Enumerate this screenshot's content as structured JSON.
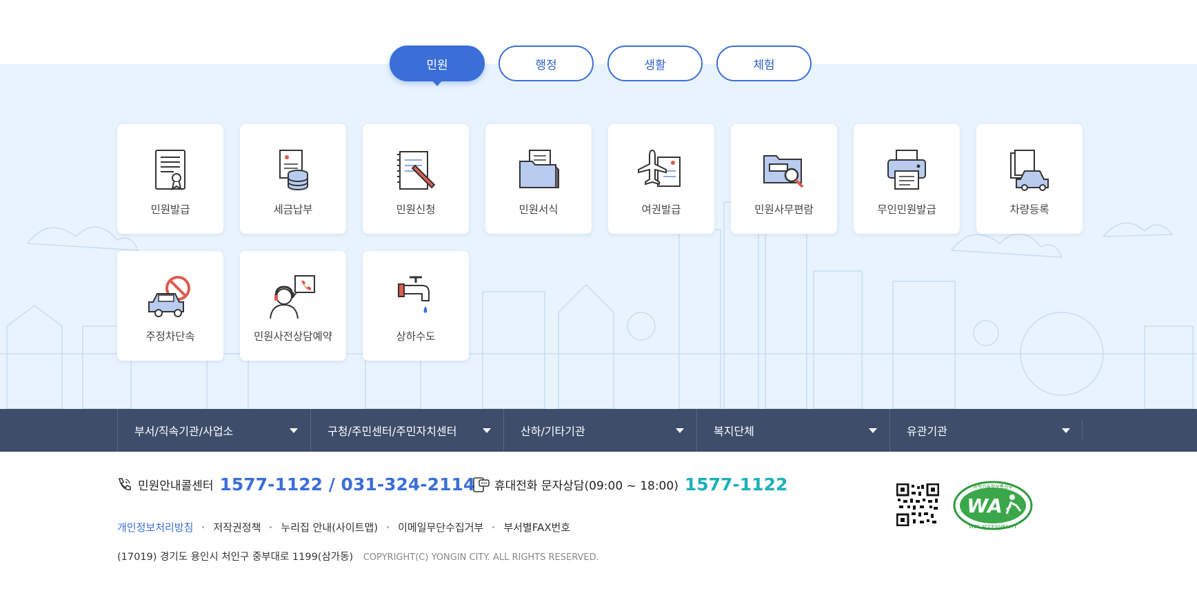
{
  "tabs": [
    {
      "label": "민원",
      "active": true
    },
    {
      "label": "행정",
      "active": false
    },
    {
      "label": "생활",
      "active": false
    },
    {
      "label": "체험",
      "active": false
    }
  ],
  "services": [
    {
      "label": "민원발급",
      "icon": "certificate-document-icon"
    },
    {
      "label": "세금납부",
      "icon": "tax-coins-icon"
    },
    {
      "label": "민원신청",
      "icon": "notebook-pen-icon"
    },
    {
      "label": "민원서식",
      "icon": "folder-document-icon"
    },
    {
      "label": "여권발급",
      "icon": "airplane-document-icon"
    },
    {
      "label": "민원사무편람",
      "icon": "folder-magnifier-icon"
    },
    {
      "label": "무인민원발급",
      "icon": "printer-icon"
    },
    {
      "label": "차량등록",
      "icon": "car-document-icon"
    },
    {
      "label": "주정차단속",
      "icon": "no-parking-car-icon"
    },
    {
      "label": "민원사전상담예약",
      "icon": "consultant-phone-icon"
    },
    {
      "label": "상하수도",
      "icon": "water-faucet-icon"
    }
  ],
  "agencies": [
    {
      "label": "부서/직속기관/사업소"
    },
    {
      "label": "구청/주민센터/주민자치센터"
    },
    {
      "label": "산하/기타기관"
    },
    {
      "label": "복지단체"
    },
    {
      "label": "유관기관"
    }
  ],
  "footer": {
    "call_center_label": "민원안내콜센터",
    "call_center_number": "1577-1122 / 031-324-2114",
    "sms_label": "휴대전화 문자상담(09:00 ~ 18:00)",
    "sms_number": "1577-1122",
    "links": [
      "개인정보처리방침",
      "저작권정책",
      "누리집 안내(사이트맵)",
      "이메일무단수집거부",
      "부서별FAX번호"
    ],
    "address": "(17019) 경기도 용인시 처인구 중부대로 1199(삼가동)",
    "copyright": "COPYRIGHT(C) YONGIN CITY. ALL RIGHTS RESERVED.",
    "wa_mark_top": "과학기술정보통신부",
    "wa_mark_bottom": "WEB ACCESSIBILITY",
    "wa_mark_logo": "WA"
  },
  "colors": {
    "accent": "#3a6fd8",
    "band_background": "#e8f3fd",
    "navbar": "#3d4d6a",
    "sms_number": "#1cb0b8"
  }
}
